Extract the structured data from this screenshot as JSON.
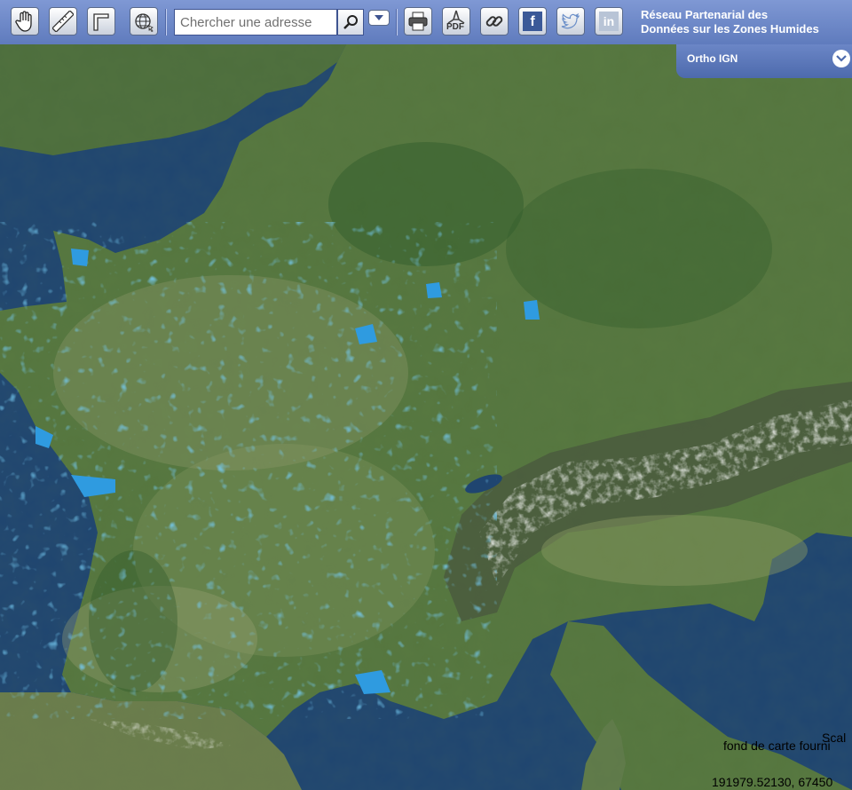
{
  "toolbar": {
    "tools": [
      {
        "name": "pan",
        "icon": "hand-icon"
      },
      {
        "name": "measure-distance",
        "icon": "ruler-icon"
      },
      {
        "name": "measure-area",
        "icon": "area-angle-icon"
      },
      {
        "name": "coordinates",
        "icon": "globe-icon"
      }
    ],
    "search": {
      "placeholder": "Chercher une adresse"
    },
    "actions": [
      {
        "name": "print",
        "icon": "printer-icon"
      },
      {
        "name": "pdf",
        "icon": "pdf-icon",
        "label": "PDF"
      },
      {
        "name": "permalink",
        "icon": "link-icon"
      },
      {
        "name": "facebook",
        "icon": "facebook-icon",
        "label": "f"
      },
      {
        "name": "twitter",
        "icon": "twitter-icon"
      },
      {
        "name": "linkedin",
        "icon": "linkedin-icon",
        "label": "in"
      }
    ]
  },
  "site": {
    "title_line1": "Réseau Partenarial des",
    "title_line2": "Données sur les Zones Humides"
  },
  "layer": {
    "current": "Ortho IGN"
  },
  "map": {
    "scale_text": "Scal",
    "attribution": "fond de carte fourni",
    "coordinates": "191979.52130, 67450"
  },
  "colors": {
    "toolbar": "#6e88c8",
    "wetlands": "#2f9be0",
    "sea": "#1f4570"
  }
}
